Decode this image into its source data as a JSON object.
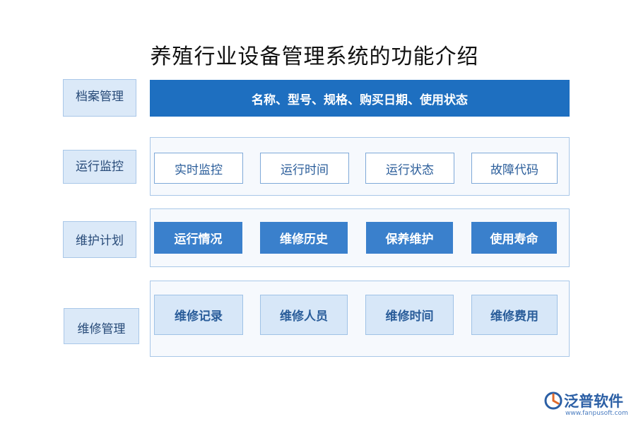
{
  "title": "养殖行业设备管理系统的功能介绍",
  "sections": [
    {
      "label": "档案管理",
      "bar_text": "名称、型号、规格、购买日期、使用状态"
    },
    {
      "label": "运行监控",
      "items": [
        "实时监控",
        "运行时间",
        "运行状态",
        "故障代码"
      ]
    },
    {
      "label": "维护计划",
      "items": [
        "运行情况",
        "维修历史",
        "保养维护",
        "使用寿命"
      ]
    },
    {
      "label": "维修管理",
      "items": [
        "维修记录",
        "维修人员",
        "维修时间",
        "维修费用"
      ]
    }
  ],
  "logo": {
    "name": "泛普软件",
    "url": "www.fanpusoft.com"
  },
  "colors": {
    "primary": "#1e6fc0",
    "solid_box": "#3a80cc",
    "light_box": "#d7e7f8",
    "label_bg": "#dbe9f8"
  }
}
